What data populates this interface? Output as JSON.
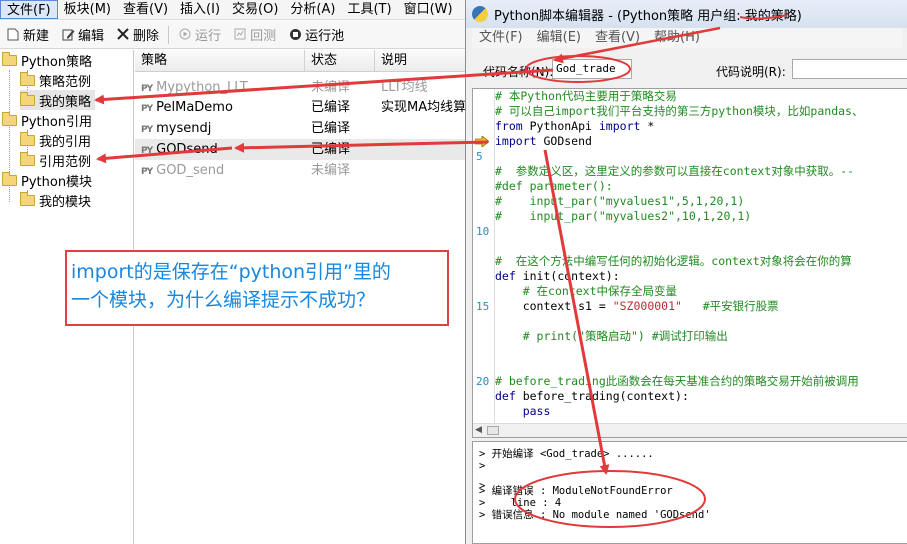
{
  "main_menu": [
    "文件(F)",
    "板块(M)",
    "查看(V)",
    "插入(I)",
    "交易(O)",
    "分析(A)",
    "工具(T)",
    "窗口(W)"
  ],
  "toolbar": {
    "new": "新建",
    "edit": "编辑",
    "delete": "删除",
    "run": "运行",
    "backtest": "回测",
    "run_pool": "运行池"
  },
  "tree": {
    "python_strategy": "Python策略",
    "strategy_example": "策略范例",
    "my_strategy": "我的策略",
    "python_ref": "Python引用",
    "my_ref": "我的引用",
    "ref_example": "引用范例",
    "python_module": "Python模块",
    "my_module": "我的模块"
  },
  "table": {
    "headers": [
      "策略",
      "状态",
      "说明"
    ],
    "rows": [
      {
        "name": "Mypython_LLT",
        "status": "未编译",
        "desc": "LLT均线"
      },
      {
        "name": "PelMaDemo",
        "status": "已编译",
        "desc": "实现MA均线算"
      },
      {
        "name": "mysendj",
        "status": "已编译",
        "desc": ""
      },
      {
        "name": "GODsend",
        "status": "已编译",
        "desc": ""
      },
      {
        "name": "GOD_send",
        "status": "未编译",
        "desc": ""
      }
    ]
  },
  "editor": {
    "title": "Python脚本编辑器 - (Python策略 用户组: 我的策略)",
    "menu": [
      "文件(F)",
      "编辑(E)",
      "查看(V)",
      "帮助(H)"
    ],
    "code_name_label": "代码名称(N):",
    "code_name_value": "God_trade",
    "code_desc_label": "代码说明(R):",
    "code_desc_value": "",
    "line_numbers": [
      "5",
      "10",
      "15",
      "20"
    ],
    "code": {
      "l1": "# 本Python代码主要用于策略交易",
      "l2": "# 可以自己import我们平台支持的第三方python模块，比如pandas、",
      "l3a": "from",
      "l3b": " PythonApi ",
      "l3c": "import",
      "l3d": " *",
      "l4a": "import",
      "l4b": " GODsend",
      "l6": "#  参数定义区，这里定义的参数可以直接在context对象中获取。--",
      "l7": "#def parameter():",
      "l8": "#    input_par(\"myvalues1\",5,1,20,1)",
      "l9": "#    input_par(\"myvalues2\",10,1,20,1)",
      "l11": "#  在这个方法中编写任何的初始化逻辑。context对象将会在你的算",
      "l12a": "def",
      "l12b": " init(context):",
      "l13": "    # 在context中保存全局变量",
      "l14a": "    context.s1 = ",
      "l14b": "\"SZ000001\"",
      "l14c": "   #平安银行股票",
      "l16": "    # print(\"策略启动\") #调试打印输出",
      "l20": "# before_trading此函数会在每天基准合约的策略交易开始前被调用",
      "l21a": "def",
      "l21b": " before_trading(context):",
      "l22": "    pass"
    },
    "output": {
      "o1": "> 开始编译 <God_trade> ......",
      "o2": ">",
      "o3": ">",
      "o4": "> 编译错误 : ModuleNotFoundError",
      "o5": ">    line : 4",
      "o6": "> 错误信息 : No module named 'GODsend'"
    }
  },
  "annotation": {
    "line1": "import的是保存在“python引用”里的",
    "line2": "一个模块，为什么编译提示不成功？"
  },
  "colors": {
    "annotation_red": "#e03a3a",
    "annotation_text_blue": "#1787e0",
    "comment_green": "#218a21",
    "keyword_navy": "#00008b",
    "string_red": "#c0292f",
    "line_number_blue": "#2b8bbf"
  }
}
